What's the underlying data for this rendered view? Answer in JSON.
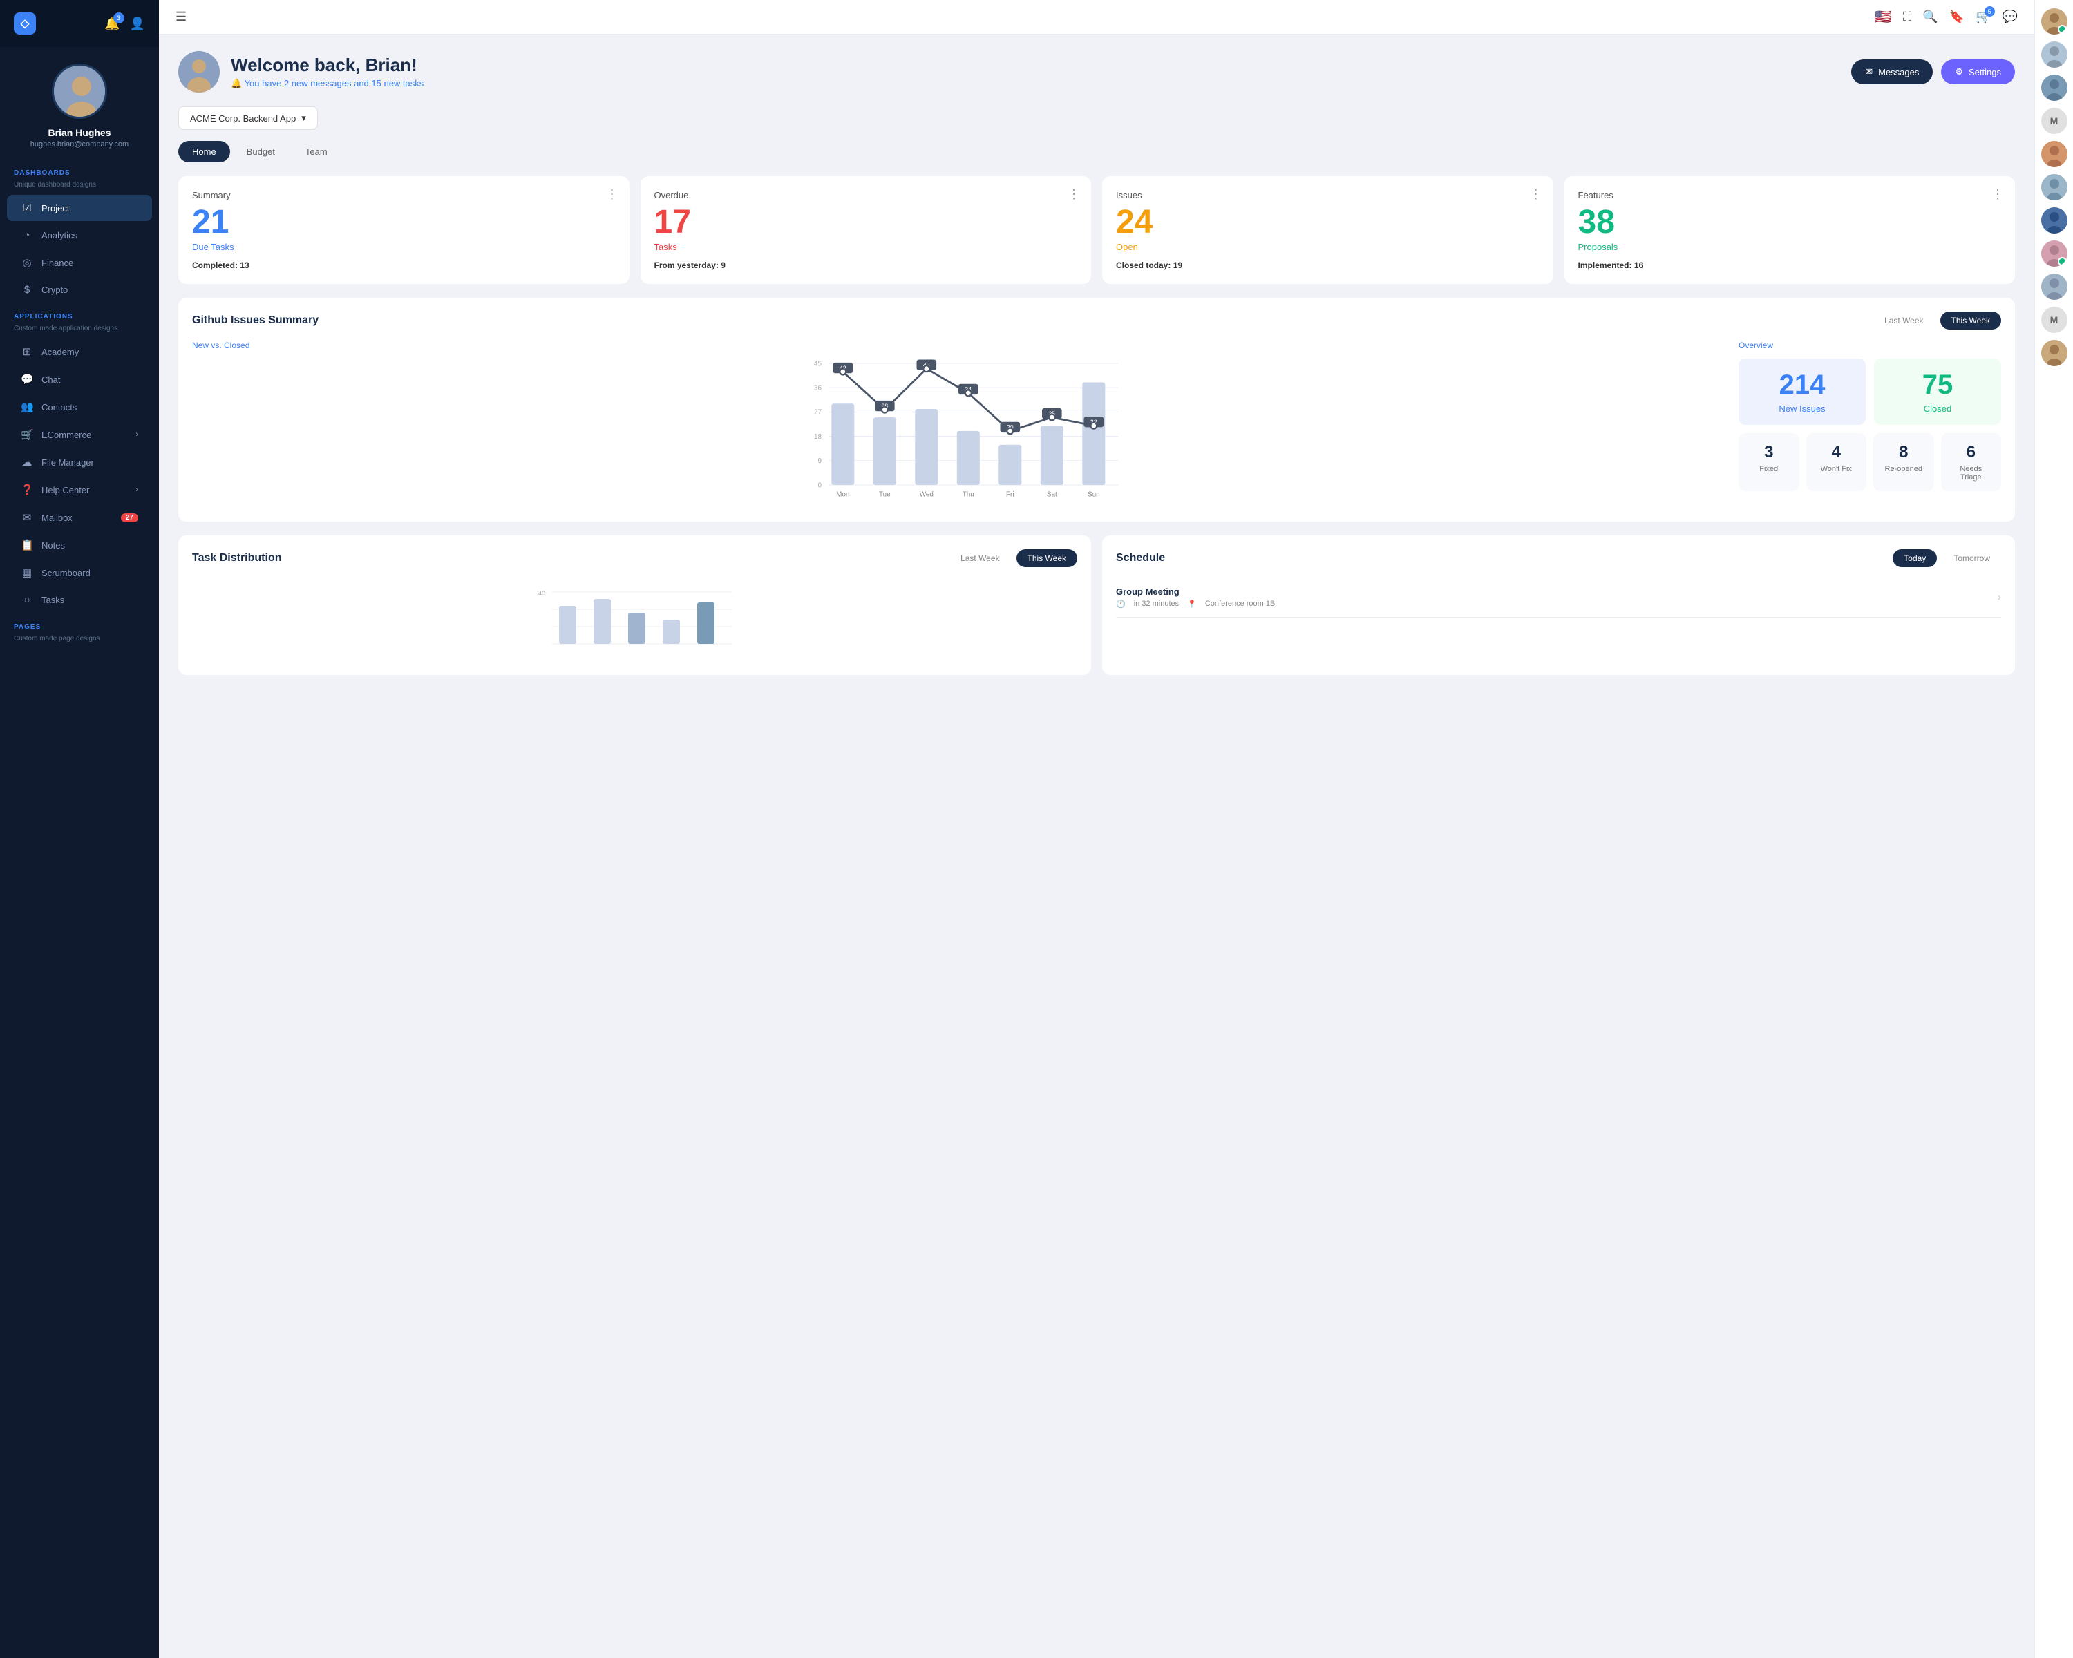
{
  "sidebar": {
    "logo_label": "◇",
    "notification_badge": "3",
    "user": {
      "name": "Brian Hughes",
      "email": "hughes.brian@company.com"
    },
    "dashboards_label": "DASHBOARDS",
    "dashboards_sub": "Unique dashboard designs",
    "applications_label": "APPLICATIONS",
    "applications_sub": "Custom made application designs",
    "pages_label": "PAGES",
    "pages_sub": "Custom made page designs",
    "nav_items": [
      {
        "id": "project",
        "label": "Project",
        "icon": "☑",
        "active": true
      },
      {
        "id": "analytics",
        "label": "Analytics",
        "icon": "○"
      },
      {
        "id": "finance",
        "label": "Finance",
        "icon": "◎"
      },
      {
        "id": "crypto",
        "label": "Crypto",
        "icon": "◉"
      }
    ],
    "app_items": [
      {
        "id": "academy",
        "label": "Academy",
        "icon": "⊞"
      },
      {
        "id": "chat",
        "label": "Chat",
        "icon": "☐"
      },
      {
        "id": "contacts",
        "label": "Contacts",
        "icon": "⊙"
      },
      {
        "id": "ecommerce",
        "label": "ECommerce",
        "icon": "◫",
        "arrow": true
      },
      {
        "id": "file-manager",
        "label": "File Manager",
        "icon": "☁"
      },
      {
        "id": "help-center",
        "label": "Help Center",
        "icon": "?",
        "arrow": true
      },
      {
        "id": "mailbox",
        "label": "Mailbox",
        "icon": "✉",
        "badge": "27"
      },
      {
        "id": "notes",
        "label": "Notes",
        "icon": "📝"
      },
      {
        "id": "scrumboard",
        "label": "Scrumboard",
        "icon": "▦"
      },
      {
        "id": "tasks",
        "label": "Tasks",
        "icon": "○"
      }
    ]
  },
  "topbar": {
    "cart_badge": "5"
  },
  "welcome": {
    "title": "Welcome back, Brian!",
    "subtitle": "You have 2 new messages and 15 new tasks",
    "messages_btn": "Messages",
    "settings_btn": "Settings"
  },
  "project_selector": {
    "label": "ACME Corp. Backend App"
  },
  "tabs": [
    {
      "id": "home",
      "label": "Home",
      "active": true
    },
    {
      "id": "budget",
      "label": "Budget"
    },
    {
      "id": "team",
      "label": "Team"
    }
  ],
  "summary_cards": [
    {
      "title": "Summary",
      "number": "21",
      "label": "Due Tasks",
      "color": "blue",
      "footer_label": "Completed:",
      "footer_value": "13"
    },
    {
      "title": "Overdue",
      "number": "17",
      "label": "Tasks",
      "color": "red",
      "footer_label": "From yesterday:",
      "footer_value": "9"
    },
    {
      "title": "Issues",
      "number": "24",
      "label": "Open",
      "color": "orange",
      "footer_label": "Closed today:",
      "footer_value": "19"
    },
    {
      "title": "Features",
      "number": "38",
      "label": "Proposals",
      "color": "green",
      "footer_label": "Implemented:",
      "footer_value": "16"
    }
  ],
  "github_section": {
    "title": "Github Issues Summary",
    "last_week_label": "Last Week",
    "this_week_label": "This Week",
    "chart_label": "New vs. Closed",
    "days": [
      "Mon",
      "Tue",
      "Wed",
      "Thu",
      "Fri",
      "Sat",
      "Sun"
    ],
    "line_values": [
      42,
      28,
      43,
      34,
      20,
      25,
      22
    ],
    "bar_values": [
      30,
      25,
      28,
      20,
      15,
      22,
      38
    ],
    "y_labels": [
      "0",
      "9",
      "18",
      "27",
      "36",
      "45"
    ],
    "overview": {
      "title": "Overview",
      "new_issues": "214",
      "new_label": "New Issues",
      "closed": "75",
      "closed_label": "Closed",
      "stats": [
        {
          "num": "3",
          "label": "Fixed"
        },
        {
          "num": "4",
          "label": "Won't Fix"
        },
        {
          "num": "8",
          "label": "Re-opened"
        },
        {
          "num": "6",
          "label": "Needs Triage"
        }
      ]
    }
  },
  "task_distribution": {
    "title": "Task Distribution",
    "last_week_label": "Last Week",
    "this_week_label": "This Week"
  },
  "schedule": {
    "title": "Schedule",
    "today_label": "Today",
    "tomorrow_label": "Tomorrow",
    "meeting": {
      "name": "Group Meeting",
      "time": "in 32 minutes",
      "location": "Conference room 1B"
    }
  },
  "right_panel": {
    "avatars": [
      {
        "id": "rp1",
        "online": true,
        "color": "#c9a87c"
      },
      {
        "id": "rp2",
        "online": false,
        "color": "#b0c4d8"
      },
      {
        "id": "rp3",
        "online": false,
        "color": "#7a9bb5"
      },
      {
        "id": "rp4",
        "online": false,
        "color": "#e8c4a0",
        "letter": "M"
      },
      {
        "id": "rp5",
        "online": false,
        "color": "#c9a87c"
      },
      {
        "id": "rp6",
        "online": false,
        "color": "#9bb5c9"
      },
      {
        "id": "rp7",
        "online": false,
        "color": "#4a6fa5"
      },
      {
        "id": "rp8",
        "online": true,
        "color": "#d4a0b0"
      },
      {
        "id": "rp9",
        "online": false,
        "color": "#a0b4c8"
      },
      {
        "id": "rp10",
        "online": false,
        "color": "#e8c4a0",
        "letter": "M"
      },
      {
        "id": "rp11",
        "online": false,
        "color": "#c9a87c"
      }
    ]
  }
}
